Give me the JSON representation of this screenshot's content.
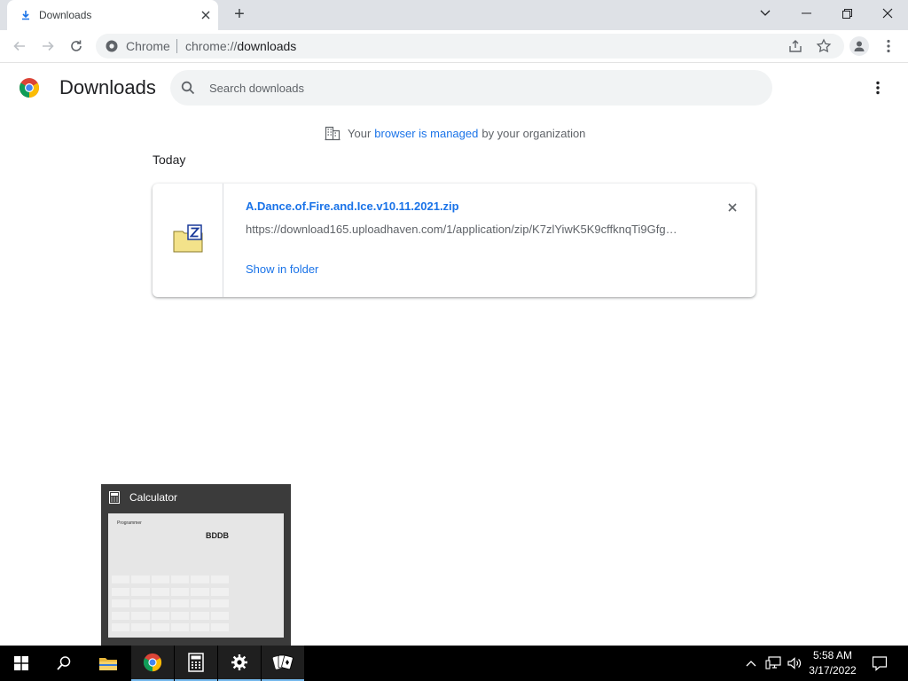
{
  "browser": {
    "tab_title": "Downloads",
    "new_tab_symbol": "+",
    "omnibox_chip": "Chrome",
    "url_scheme": "chrome://",
    "url_path": "downloads"
  },
  "page": {
    "title": "Downloads",
    "search_placeholder": "Search downloads",
    "managed_prefix": "Your",
    "managed_link": "browser is managed",
    "managed_suffix": "by your organization",
    "date_heading": "Today"
  },
  "download": {
    "file_name": "A.Dance.of.Fire.and.Ice.v10.11.2021.zip",
    "url": "https://download165.uploadhaven.com/1/application/zip/K7zlYiwK5K9cffknqTi9Gfg…",
    "show_in_folder": "Show in folder"
  },
  "thumbnail": {
    "title": "Calculator",
    "preview_mode": "Programmer",
    "preview_display": "BDDB"
  },
  "taskbar": {
    "time": "5:58 AM",
    "date": "3/17/2022"
  },
  "colors": {
    "accent": "#1a73e8",
    "tabstrip": "#dee1e6",
    "taskbar": "#000000"
  }
}
